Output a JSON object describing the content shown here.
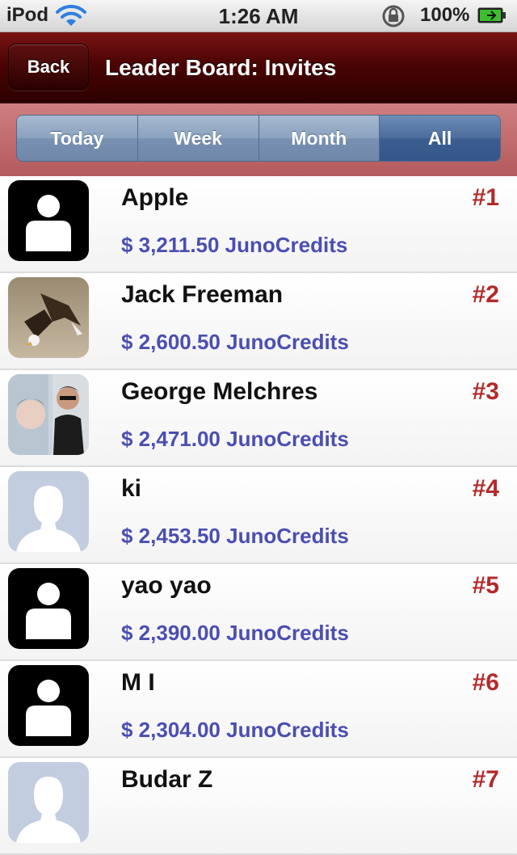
{
  "status_bar": {
    "carrier": "iPod",
    "time": "1:26 AM",
    "battery": "100%"
  },
  "nav": {
    "back_label": "Back",
    "title": "Leader Board: Invites"
  },
  "segments": {
    "items": [
      "Today",
      "Week",
      "Month",
      "All"
    ],
    "selected": "All"
  },
  "leaders": [
    {
      "name": "Apple",
      "credits": "$ 3,211.50 JunoCredits",
      "rank": "#1",
      "avatar": "default-silhouette-black"
    },
    {
      "name": "Jack Freeman",
      "credits": "$ 2,600.50 JunoCredits",
      "rank": "#2",
      "avatar": "eagle-photo"
    },
    {
      "name": "George Melchres",
      "credits": "$ 2,471.00 JunoCredits",
      "rank": "#3",
      "avatar": "person-photo"
    },
    {
      "name": "ki",
      "credits": "$ 2,453.50 JunoCredits",
      "rank": "#4",
      "avatar": "default-silhouette-light"
    },
    {
      "name": "yao yao",
      "credits": "$ 2,390.00 JunoCredits",
      "rank": "#5",
      "avatar": "default-silhouette-black"
    },
    {
      "name": "M I",
      "credits": "$ 2,304.00 JunoCredits",
      "rank": "#6",
      "avatar": "default-silhouette-black"
    },
    {
      "name": "Budar Z",
      "credits": "",
      "rank": "#7",
      "avatar": "default-silhouette-light"
    }
  ],
  "colors": {
    "nav_bar": "#4a0404",
    "segment_bg": "#b35a5d",
    "segment_active": "#3b5d8f",
    "credits": "#4b4eb1",
    "rank": "#b32a2a"
  }
}
